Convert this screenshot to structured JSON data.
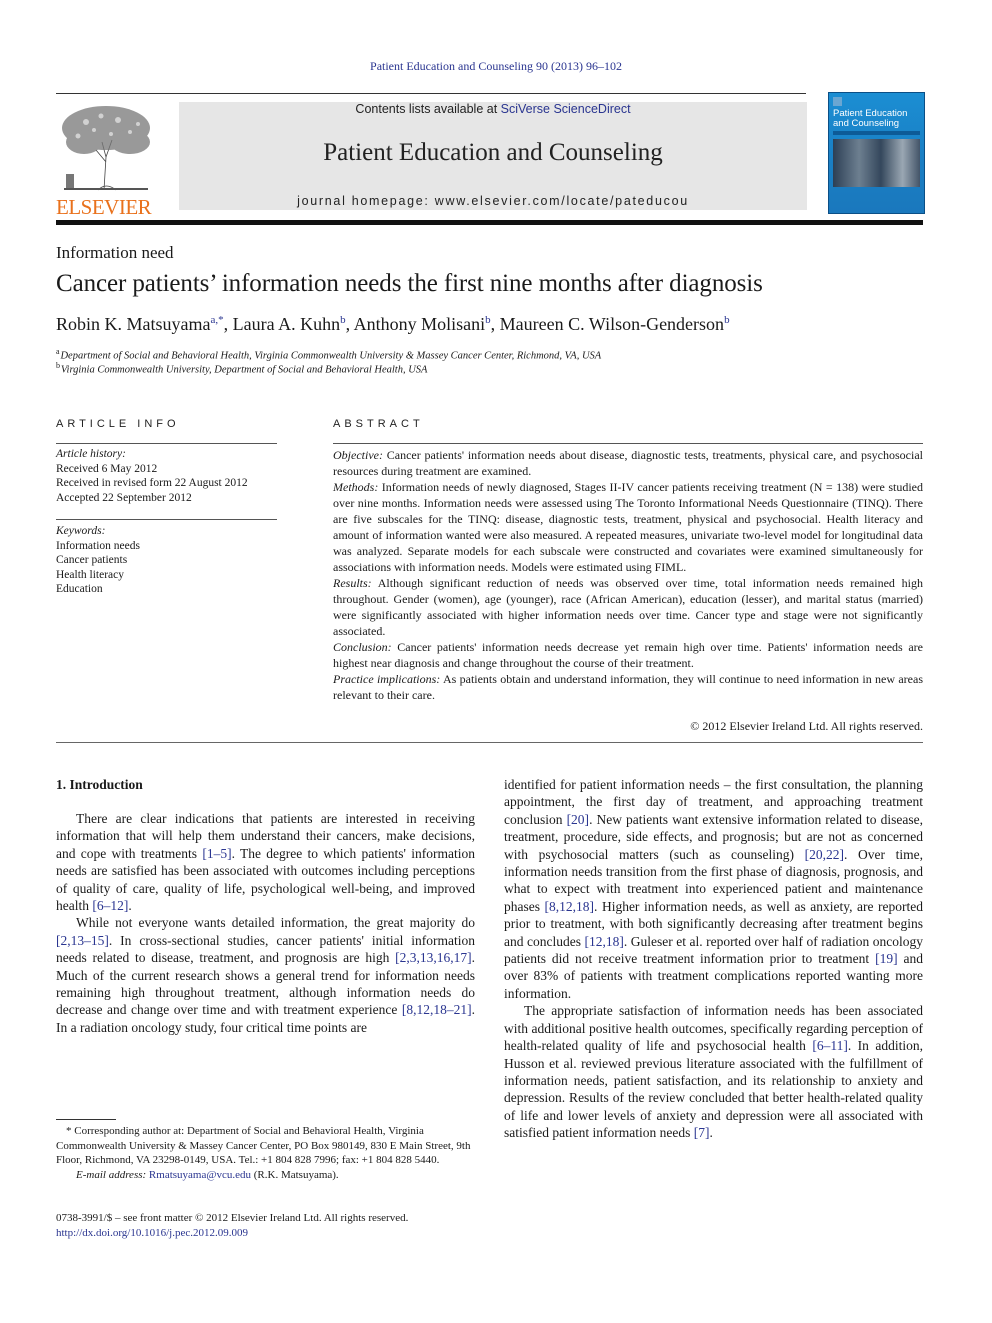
{
  "running_head": "Patient Education and Counseling 90 (2013) 96–102",
  "masthead": {
    "publisher_logo_text": "ELSEVIER",
    "contents_prefix": "Contents lists available at ",
    "contents_link": "SciVerse ScienceDirect",
    "journal_title": "Patient Education and Counseling",
    "homepage": "journal homepage: www.elsevier.com/locate/pateducou",
    "cover_title_line1": "Patient Education",
    "cover_title_line2": "and Counseling"
  },
  "article": {
    "section_type": "Information need",
    "title": "Cancer patients’ information needs the first nine months after diagnosis",
    "authors": [
      {
        "name": "Robin K. Matsuyama",
        "sup": "a,*",
        "sep": ", "
      },
      {
        "name": "Laura A. Kuhn",
        "sup": "b",
        "sep": ", "
      },
      {
        "name": "Anthony Molisani",
        "sup": "b",
        "sep": ", "
      },
      {
        "name": "Maureen C. Wilson-Genderson",
        "sup": "b",
        "sep": ""
      }
    ],
    "affiliations": [
      {
        "mark": "a",
        "text": "Department of Social and Behavioral Health, Virginia Commonwealth University & Massey Cancer Center, Richmond, VA, USA"
      },
      {
        "mark": "b",
        "text": "Virginia Commonwealth University, Department of Social and Behavioral Health, USA"
      }
    ]
  },
  "article_info": {
    "heading": "ARTICLE INFO",
    "history_label": "Article history:",
    "history": [
      "Received 6 May 2012",
      "Received in revised form 22 August 2012",
      "Accepted 22 September 2012"
    ],
    "keywords_label": "Keywords:",
    "keywords": [
      "Information needs",
      "Cancer patients",
      "Health literacy",
      "Education"
    ]
  },
  "abstract": {
    "heading": "ABSTRACT",
    "sections": [
      {
        "label": "Objective:",
        "text": " Cancer patients' information needs about disease, diagnostic tests, treatments, physical care, and psychosocial resources during treatment are examined."
      },
      {
        "label": "Methods:",
        "text": " Information needs of newly diagnosed, Stages II-IV cancer patients receiving treatment (N = 138) were studied over nine months. Information needs were assessed using The Toronto Informational Needs Questionnaire (TINQ). There are five subscales for the TINQ: disease, diagnostic tests, treatment, physical and psychosocial. Health literacy and amount of information wanted were also measured. A repeated measures, univariate two-level model for longitudinal data was analyzed. Separate models for each subscale were constructed and covariates were examined simultaneously for associations with information needs. Models were estimated using FIML."
      },
      {
        "label": "Results:",
        "text": " Although significant reduction of needs was observed over time, total information needs remained high throughout. Gender (women), age (younger), race (African American), education (lesser), and marital status (married) were significantly associated with higher information needs over time. Cancer type and stage were not significantly associated."
      },
      {
        "label": "Conclusion:",
        "text": " Cancer patients' information needs decrease yet remain high over time. Patients' information needs are highest near diagnosis and change throughout the course of their treatment."
      },
      {
        "label": "Practice implications:",
        "text": " As patients obtain and understand information, they will continue to need information in new areas relevant to their care."
      }
    ],
    "copyright": "© 2012 Elsevier Ireland Ltd. All rights reserved."
  },
  "introduction": {
    "heading": "1.  Introduction",
    "left_paragraphs": [
      [
        {
          "t": "There are clear indications that patients are interested in receiving information that will help them understand their cancers, make decisions, and cope with treatments "
        },
        {
          "ref": "[1–5]"
        },
        {
          "t": ". The degree to which patients' information needs are satisfied has been associated with outcomes including perceptions of quality of care, quality of life, psychological well-being, and improved health "
        },
        {
          "ref": "[6–12]"
        },
        {
          "t": "."
        }
      ],
      [
        {
          "t": "While not everyone wants detailed information, the great majority do "
        },
        {
          "ref": "[2,13–15]"
        },
        {
          "t": ". In cross-sectional studies, cancer patients' initial information needs related to disease, treatment, and prognosis are high "
        },
        {
          "ref": "[2,3,13,16,17]"
        },
        {
          "t": ". Much of the current research shows a general trend for information needs remaining high throughout treatment, although information needs do decrease and change over time and with treatment experience "
        },
        {
          "ref": "[8,12,18–21]"
        },
        {
          "t": ". In a radiation oncology study, four critical time points are"
        }
      ]
    ],
    "right_paragraphs": [
      [
        {
          "t": "identified for patient information needs – the first consultation, the planning appointment, the first day of treatment, and approaching treatment conclusion "
        },
        {
          "ref": "[20]"
        },
        {
          "t": ". New patients want extensive information related to disease, treatment, procedure, side effects, and prognosis; but are not as concerned with psychosocial matters (such as counseling) "
        },
        {
          "ref": "[20,22]"
        },
        {
          "t": ". Over time, information needs transition from the first phase of diagnosis, prognosis, and what to expect with treatment into experienced patient and maintenance phases "
        },
        {
          "ref": "[8,12,18]"
        },
        {
          "t": ". Higher information needs, as well as anxiety, are reported prior to treatment, with both significantly decreasing after treatment begins and concludes "
        },
        {
          "ref": "[12,18]"
        },
        {
          "t": ". Guleser et al. reported over half of radiation oncology patients did not receive treatment information prior to treatment "
        },
        {
          "ref": "[19]"
        },
        {
          "t": " and over 83% of patients with treatment complications reported wanting more information."
        }
      ],
      [
        {
          "t": "The appropriate satisfaction of information needs has been associated with additional positive health outcomes, specifically regarding perception of health-related quality of life and psychosocial health "
        },
        {
          "ref": "[6–11]"
        },
        {
          "t": ". In addition, Husson et al. reviewed previous literature associated with the fulfillment of information needs, patient satisfaction, and its relationship to anxiety and depression. Results of the review concluded that better health-related quality of life and lower levels of anxiety and depression were all associated with satisfied patient information needs "
        },
        {
          "ref": "[7]"
        },
        {
          "t": "."
        }
      ]
    ]
  },
  "footnote": {
    "corresponding": "* Corresponding author at: Department of Social and Behavioral Health, Virginia Commonwealth University & Massey Cancer Center, PO Box 980149, 830 E Main Street, 9th Floor, Richmond, VA 23298-0149, USA. Tel.: +1 804 828 7996; fax: +1 804 828 5440.",
    "email_label": "E-mail address:",
    "email": "Rmatsuyama@vcu.edu",
    "email_suffix": " (R.K. Matsuyama)."
  },
  "front_matter": {
    "issn_line": "0738-3991/$ – see front matter © 2012 Elsevier Ireland Ltd. All rights reserved.",
    "doi": "http://dx.doi.org/10.1016/j.pec.2012.09.009"
  },
  "colors": {
    "link": "#2a3590",
    "elsevier_orange": "#e9711c",
    "banner_bg": "#e6e6e6",
    "cover_blue": "#1a7fc4"
  }
}
